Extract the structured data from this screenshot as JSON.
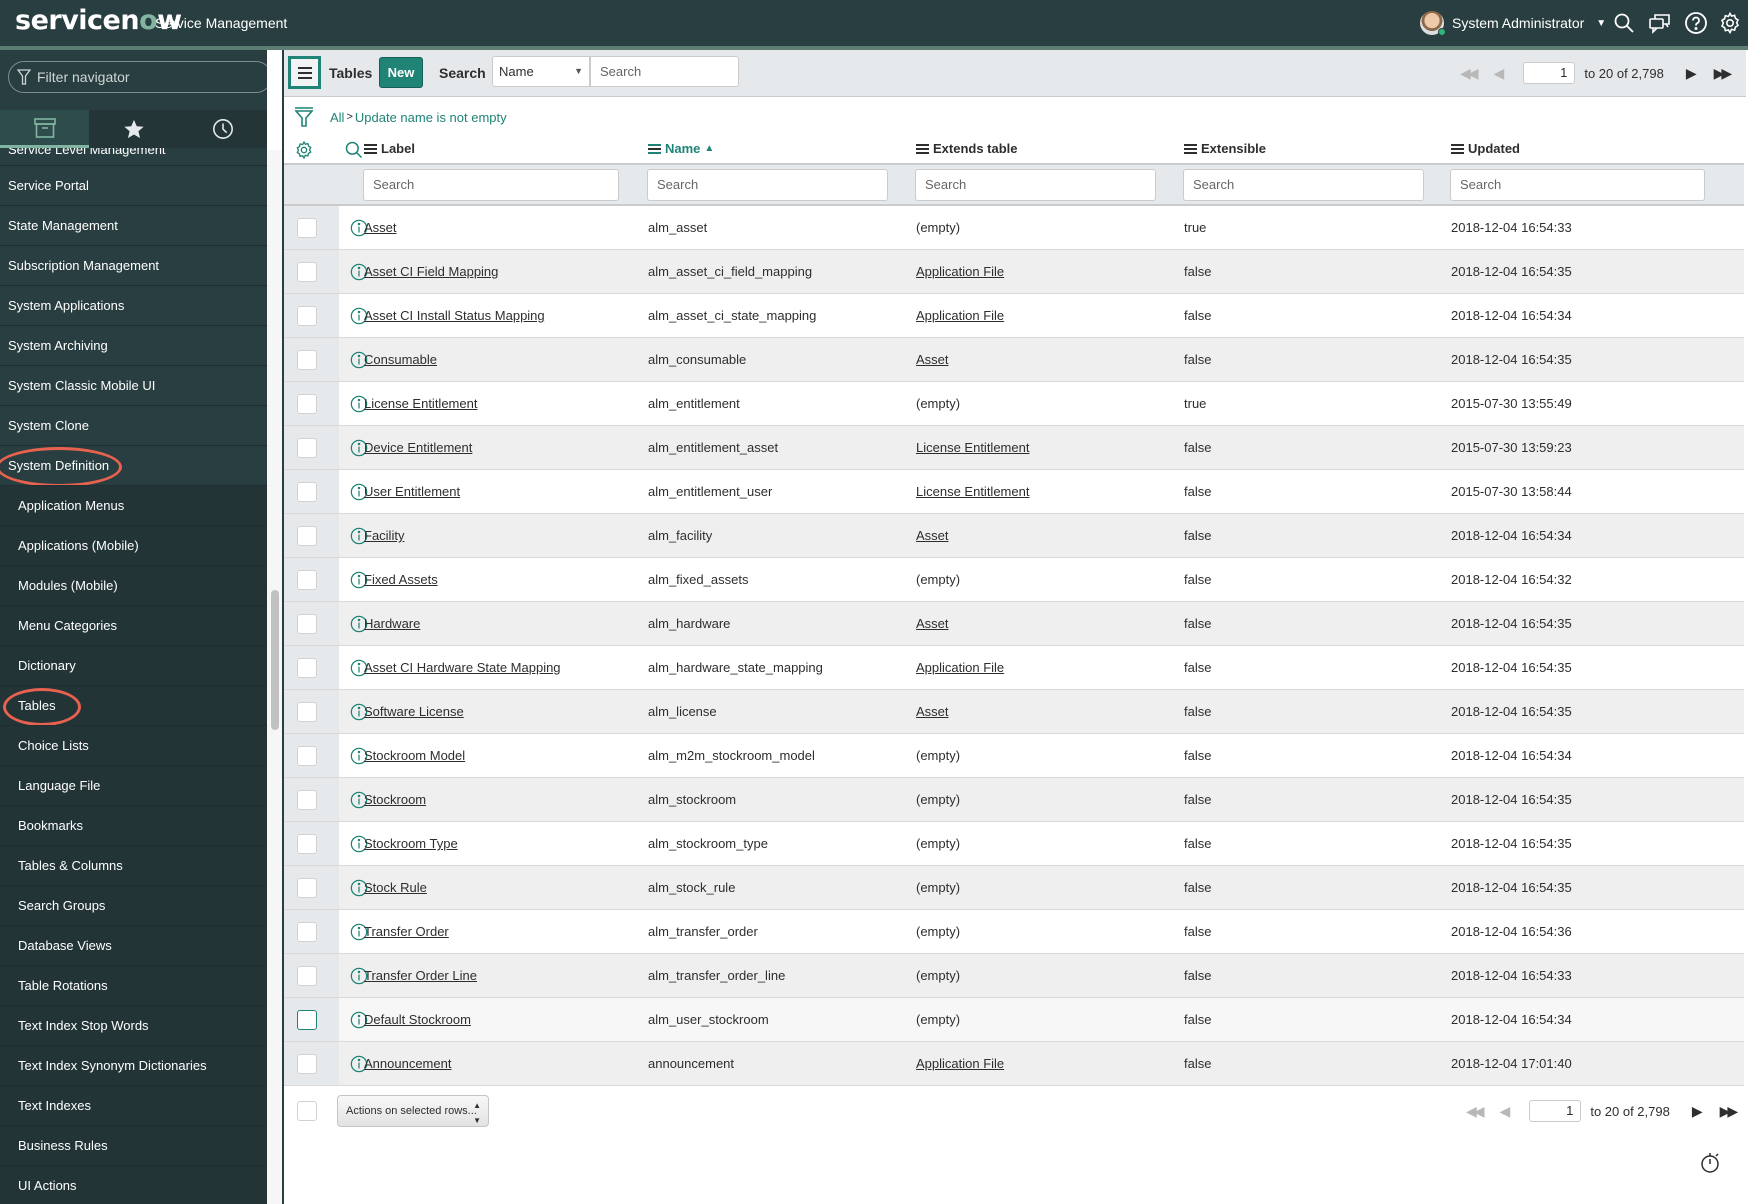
{
  "header": {
    "logo_text": "servicenow",
    "app_name": "Service Management",
    "user_name": "System Administrator",
    "icons": [
      "search-icon",
      "chat-icon",
      "help-icon",
      "gear-icon"
    ]
  },
  "sidebar": {
    "filter_placeholder": "Filter navigator",
    "tabs": [
      "all-apps-icon",
      "favorites-star-icon",
      "history-clock-icon"
    ],
    "items": [
      {
        "label": "Service Level Management",
        "type": "app",
        "cut": true
      },
      {
        "label": "Service Portal",
        "type": "app"
      },
      {
        "label": "State Management",
        "type": "app"
      },
      {
        "label": "Subscription Management",
        "type": "app"
      },
      {
        "label": "System Applications",
        "type": "app"
      },
      {
        "label": "System Archiving",
        "type": "app"
      },
      {
        "label": "System Classic Mobile UI",
        "type": "app"
      },
      {
        "label": "System Clone",
        "type": "app"
      },
      {
        "label": "System Definition",
        "type": "app",
        "circled": true
      },
      {
        "label": "Application Menus",
        "type": "module"
      },
      {
        "label": "Applications (Mobile)",
        "type": "module"
      },
      {
        "label": "Modules (Mobile)",
        "type": "module"
      },
      {
        "label": "Menu Categories",
        "type": "module"
      },
      {
        "label": "Dictionary",
        "type": "module"
      },
      {
        "label": "Tables",
        "type": "module",
        "circled": true
      },
      {
        "label": "Choice Lists",
        "type": "module"
      },
      {
        "label": "Language File",
        "type": "module"
      },
      {
        "label": "Bookmarks",
        "type": "module"
      },
      {
        "label": "Tables & Columns",
        "type": "module"
      },
      {
        "label": "Search Groups",
        "type": "module"
      },
      {
        "label": "Database Views",
        "type": "module"
      },
      {
        "label": "Table Rotations",
        "type": "module"
      },
      {
        "label": "Text Index Stop Words",
        "type": "module"
      },
      {
        "label": "Text Index Synonym Dictionaries",
        "type": "module"
      },
      {
        "label": "Text Indexes",
        "type": "module"
      },
      {
        "label": "Business Rules",
        "type": "module"
      },
      {
        "label": "UI Actions",
        "type": "module"
      }
    ]
  },
  "toolbar": {
    "title": "Tables",
    "new_label": "New",
    "search_label": "Search",
    "search_field": "Name",
    "search_placeholder": "Search",
    "page": "1",
    "range": "to 20 of 2,798"
  },
  "breadcrumb": {
    "root": "All",
    "separator": ">",
    "condition": "Update name is not empty"
  },
  "columns": [
    {
      "label": "Label",
      "sorted": false
    },
    {
      "label": "Name",
      "sorted": true,
      "sort_dir": "▲"
    },
    {
      "label": "Extends table",
      "sorted": false
    },
    {
      "label": "Extensible",
      "sorted": false
    },
    {
      "label": "Updated",
      "sorted": false
    }
  ],
  "column_search_placeholder": "Search",
  "rows": [
    {
      "label": "Asset",
      "name": "alm_asset",
      "extends": "(empty)",
      "extensible": "true",
      "updated": "2018-12-04 16:54:33"
    },
    {
      "label": "Asset CI Field Mapping",
      "name": "alm_asset_ci_field_mapping",
      "extends": "Application File",
      "extensible": "false",
      "updated": "2018-12-04 16:54:35"
    },
    {
      "label": "Asset CI Install Status Mapping",
      "name": "alm_asset_ci_state_mapping",
      "extends": "Application File",
      "extensible": "false",
      "updated": "2018-12-04 16:54:34"
    },
    {
      "label": "Consumable",
      "name": "alm_consumable",
      "extends": "Asset",
      "extensible": "false",
      "updated": "2018-12-04 16:54:35"
    },
    {
      "label": "License Entitlement",
      "name": "alm_entitlement",
      "extends": "(empty)",
      "extensible": "true",
      "updated": "2015-07-30 13:55:49"
    },
    {
      "label": "Device Entitlement",
      "name": "alm_entitlement_asset",
      "extends": "License Entitlement",
      "extensible": "false",
      "updated": "2015-07-30 13:59:23"
    },
    {
      "label": "User Entitlement",
      "name": "alm_entitlement_user",
      "extends": "License Entitlement",
      "extensible": "false",
      "updated": "2015-07-30 13:58:44"
    },
    {
      "label": "Facility",
      "name": "alm_facility",
      "extends": "Asset",
      "extensible": "false",
      "updated": "2018-12-04 16:54:34"
    },
    {
      "label": "Fixed Assets",
      "name": "alm_fixed_assets",
      "extends": "(empty)",
      "extensible": "false",
      "updated": "2018-12-04 16:54:32"
    },
    {
      "label": "Hardware",
      "name": "alm_hardware",
      "extends": "Asset",
      "extensible": "false",
      "updated": "2018-12-04 16:54:35"
    },
    {
      "label": "Asset CI Hardware State Mapping",
      "name": "alm_hardware_state_mapping",
      "extends": "Application File",
      "extensible": "false",
      "updated": "2018-12-04 16:54:35"
    },
    {
      "label": "Software License",
      "name": "alm_license",
      "extends": "Asset",
      "extensible": "false",
      "updated": "2018-12-04 16:54:35"
    },
    {
      "label": "Stockroom Model",
      "name": "alm_m2m_stockroom_model",
      "extends": "(empty)",
      "extensible": "false",
      "updated": "2018-12-04 16:54:34"
    },
    {
      "label": "Stockroom",
      "name": "alm_stockroom",
      "extends": "(empty)",
      "extensible": "false",
      "updated": "2018-12-04 16:54:35"
    },
    {
      "label": "Stockroom Type",
      "name": "alm_stockroom_type",
      "extends": "(empty)",
      "extensible": "false",
      "updated": "2018-12-04 16:54:35"
    },
    {
      "label": "Stock Rule",
      "name": "alm_stock_rule",
      "extends": "(empty)",
      "extensible": "false",
      "updated": "2018-12-04 16:54:35"
    },
    {
      "label": "Transfer Order",
      "name": "alm_transfer_order",
      "extends": "(empty)",
      "extensible": "false",
      "updated": "2018-12-04 16:54:36"
    },
    {
      "label": "Transfer Order Line",
      "name": "alm_transfer_order_line",
      "extends": "(empty)",
      "extensible": "false",
      "updated": "2018-12-04 16:54:33"
    },
    {
      "label": "Default Stockroom",
      "name": "alm_user_stockroom",
      "extends": "(empty)",
      "extensible": "false",
      "updated": "2018-12-04 16:54:34",
      "hover": true
    },
    {
      "label": "Announcement",
      "name": "announcement",
      "extends": "Application File",
      "extensible": "false",
      "updated": "2018-12-04 17:01:40"
    }
  ],
  "footer": {
    "actions_label": "Actions on selected rows...",
    "page": "1",
    "range": "to 20 of 2,798"
  },
  "colors": {
    "header_bg": "#293e40",
    "accent": "#1f8476",
    "annotation_ring": "#e8624f"
  }
}
